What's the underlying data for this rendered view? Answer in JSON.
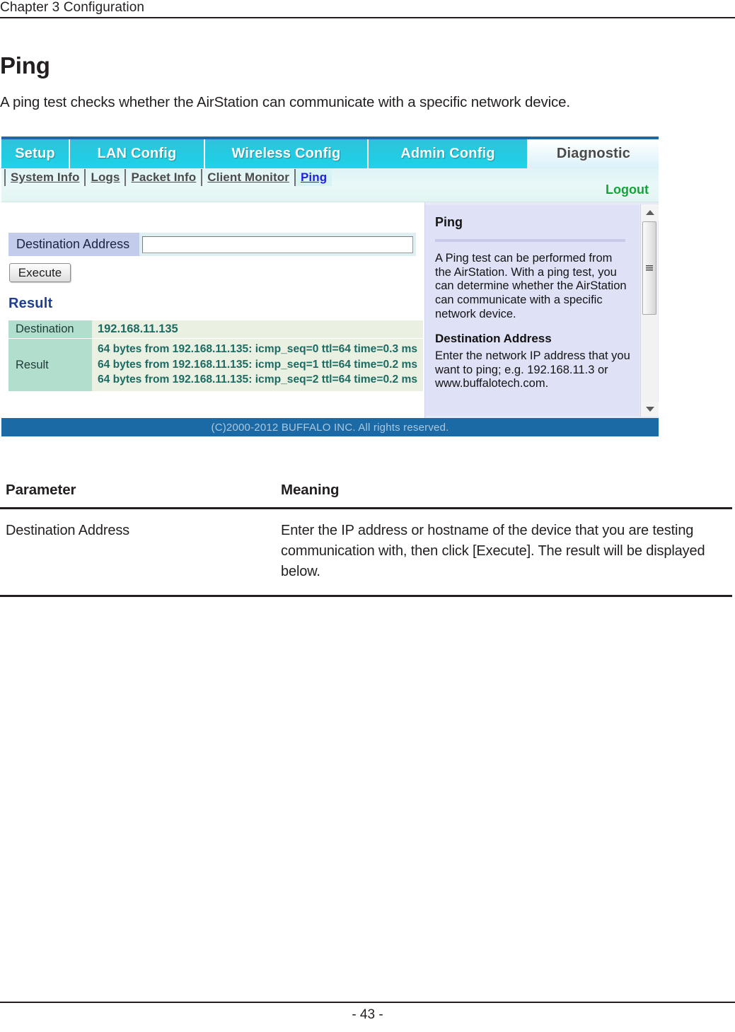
{
  "running_head": "Chapter 3  Configuration",
  "section": {
    "heading": "Ping",
    "intro": "A ping test checks whether the AirStation can communicate with a specific network device."
  },
  "screenshot": {
    "tabs": [
      {
        "label": "Setup",
        "active": false
      },
      {
        "label": "LAN Config",
        "active": false
      },
      {
        "label": "Wireless Config",
        "active": false
      },
      {
        "label": "Admin Config",
        "active": false
      },
      {
        "label": "Diagnostic",
        "active": true
      }
    ],
    "subtabs": [
      {
        "label": "System Info",
        "current": false
      },
      {
        "label": "Logs",
        "current": false
      },
      {
        "label": "Packet Info",
        "current": false
      },
      {
        "label": "Client Monitor",
        "current": false
      },
      {
        "label": "Ping",
        "current": true
      }
    ],
    "logout_label": "Logout",
    "form": {
      "destination_label": "Destination Address",
      "destination_value": "",
      "destination_placeholder": "",
      "execute_label": "Execute"
    },
    "result": {
      "heading": "Result",
      "destination_label": "Destination",
      "destination_value": "192.168.11.135",
      "result_label": "Result",
      "lines": [
        "64 bytes from 192.168.11.135: icmp_seq=0 ttl=64 time=0.3 ms",
        "64 bytes from 192.168.11.135: icmp_seq=1 ttl=64 time=0.2 ms",
        "64 bytes from 192.168.11.135: icmp_seq=2 ttl=64 time=0.2 ms"
      ]
    },
    "help": {
      "title": "Ping",
      "paragraph": "A Ping test can be performed from the AirStation. With a ping test, you can determine whether the AirStation can communicate with a specific network device.",
      "subtitle": "Destination Address",
      "subparagraph": "Enter the network IP address that you want to ping; e.g. 192.168.11.3 or www.buffalotech.com."
    },
    "footer": "(C)2000-2012 BUFFALO INC. All rights reserved.",
    "colors": {
      "tab_active_text": "#4a4a4a",
      "tab_inactive_bg": "#23cbe2",
      "logout_green": "#13a33a",
      "result_heading_blue": "#1f3f8f",
      "footer_bar_blue": "#1b6aa5",
      "help_bg": "#dfe1f6"
    }
  },
  "param_table": {
    "headers": [
      "Parameter",
      "Meaning"
    ],
    "rows": [
      {
        "parameter": "Destination Address",
        "meaning": "Enter the IP address or hostname of the device that you are testing communication with, then click [Execute]. The result will be displayed below."
      }
    ]
  },
  "page_number": "- 43 -"
}
